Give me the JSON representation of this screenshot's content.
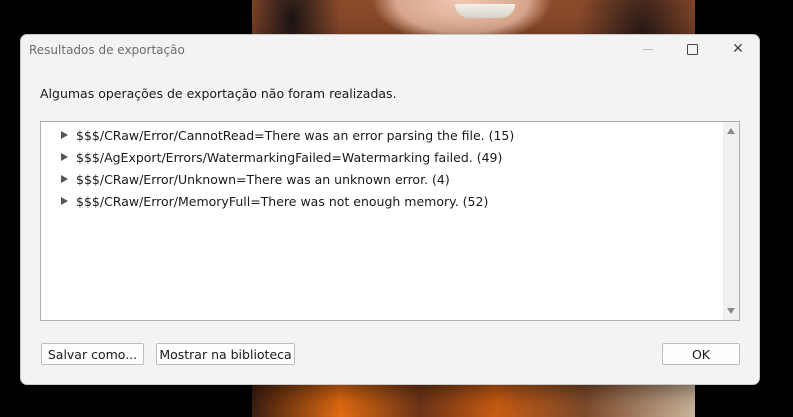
{
  "dialog": {
    "title": "Resultados de exportação",
    "message": "Algumas operações de exportação não foram realizadas.",
    "items": [
      {
        "label": "$$$/CRaw/Error/CannotRead=There was an error parsing the file. (15)"
      },
      {
        "label": "$$$/AgExport/Errors/WatermarkingFailed=Watermarking failed. (49)"
      },
      {
        "label": "$$$/CRaw/Error/Unknown=There was an unknown error. (4)"
      },
      {
        "label": "$$$/CRaw/Error/MemoryFull=There was not enough memory. (52)"
      }
    ],
    "buttons": {
      "save_as": "Salvar como...",
      "show_in_library": "Mostrar na biblioteca",
      "ok": "OK"
    },
    "window_controls": {
      "close": "✕"
    }
  },
  "colors": {
    "dialog_bg": "#f3f3f3",
    "list_bg": "#ffffff",
    "text": "#1a1a1a",
    "title_text": "#6d6d6d"
  }
}
